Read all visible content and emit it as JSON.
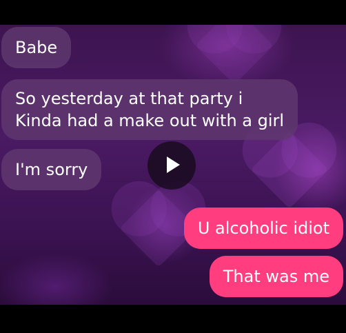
{
  "messages": [
    {
      "text": "Babe",
      "side": "received"
    },
    {
      "line1": "So yesterday at that party i",
      "line2": "Kinda had a make out with a girl",
      "side": "received"
    },
    {
      "text": "I'm sorry",
      "side": "received"
    },
    {
      "text": "U alcoholic idiot",
      "side": "sent"
    },
    {
      "text": "That was me",
      "side": "sent"
    }
  ],
  "icons": {
    "play": "play-icon"
  },
  "colors": {
    "sent_bubble": "#ff3d7f",
    "received_bubble": "#5f376e",
    "background": "#4a1a63"
  }
}
